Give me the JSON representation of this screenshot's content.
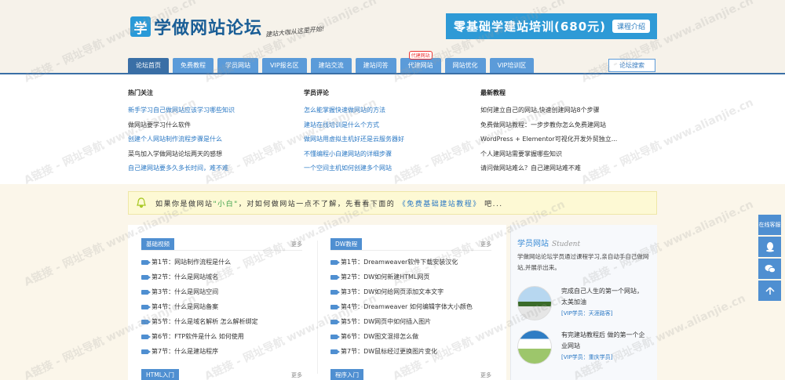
{
  "header": {
    "logo_mark": "学",
    "logo_text": "学做网站论坛",
    "slogan": "建站大咖从这里开始!",
    "banner_text": "零基础学建站培训(680元)",
    "banner_button": "课程介绍"
  },
  "nav": {
    "items": [
      {
        "label": "论坛首页"
      },
      {
        "label": "免费教程"
      },
      {
        "label": "学员网站"
      },
      {
        "label": "VIP报名区"
      },
      {
        "label": "建站交流"
      },
      {
        "label": "建站问答"
      },
      {
        "label": "代建网站",
        "badge": "代建网站"
      },
      {
        "label": "网站优化"
      },
      {
        "label": "VIP培训区"
      }
    ],
    "search_label": "论坛搜索"
  },
  "mega": {
    "col1": {
      "title": "热门关注",
      "items": [
        "新手学习自己做网站应该学习哪些知识",
        "做网站要学习什么软件",
        "创建个人网站制作流程步骤是什么",
        "菜鸟加入学做网站论坛两天的感想",
        "自己建网站要多久多长时间，难不难"
      ]
    },
    "col2": {
      "title": "学员评论",
      "items": [
        "怎么能掌握快速做网站的方法",
        "建站在线培训是什么个方式",
        "做网站用虚拟主机好还是云服务器好",
        "不懂编程小白建网站的详细步骤",
        "一个空间主机如何创建多个网站"
      ]
    },
    "col3": {
      "title": "最新教程",
      "items": [
        "如何建立自己的网站,快速创建网站8个步骤",
        "免费做网站教程：一步步教你怎么免费建网站",
        "WordPress + Elementor可视化开发外贸独立...",
        "个人建网站需要掌握哪些知识",
        "请问做网站难么？自己建网站难不难"
      ]
    }
  },
  "notice": {
    "prefix": "如果你是做网站",
    "highlight": "\"小白\"",
    "middle": "，对如何做网站一点不了解，先看看下面的",
    "link": "《免费基础建站教程》",
    "suffix": "吧..."
  },
  "sections": {
    "a": {
      "tag": "基础视频",
      "more": "更多",
      "items": [
        "第1节：网站制作流程是什么",
        "第2节：什么是网站域名",
        "第3节：什么是网站空间",
        "第4节：什么是网站备案",
        "第5节：什么是域名解析 怎么解析绑定",
        "第6节：FTP软件是什么 如何使用",
        "第7节：什么是建站程序"
      ]
    },
    "b": {
      "tag": "DW教程",
      "more": "更多",
      "items": [
        "第1节：Dreamweaver软件下载安装汉化",
        "第2节：DW如何新建HTML网页",
        "第3节：DW如何给网页添加文本文字",
        "第4节：Dreamweaver 如何编辑字体大小颜色",
        "第5节：DW网页中如何插入图片",
        "第6节：DW图文混排怎么做",
        "第7节：DW鼠标经过更换图片变化"
      ]
    },
    "c": {
      "tag": "HTML入门",
      "more": "更多"
    },
    "d": {
      "tag": "程序入门",
      "more": "更多"
    }
  },
  "sidebar": {
    "title": "学员网站",
    "title_en": "Student",
    "desc": "学做网站论坛学员通过课程学习,亲自动手自己做网站,并展示出来。",
    "cases": [
      {
        "title": "完成自己人生的第一个网站，太美加油",
        "user": "[VIP学员：天涯路客]"
      },
      {
        "title": "有完建站教程后 做的第一个企业网站",
        "user": "[VIP学员：重庆学员]"
      }
    ]
  },
  "float": {
    "service": "在线客服"
  },
  "watermark": "A链接 - 网址导航 www.alianjie.cn",
  "colors": {
    "nav": "#5b9bd9",
    "nav_active": "#3a6fa6",
    "link": "#2a78c4",
    "banner": "#2e9ad6"
  }
}
